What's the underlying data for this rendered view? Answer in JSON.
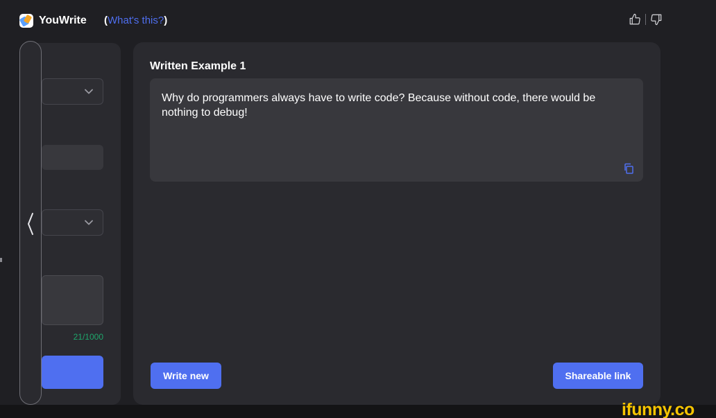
{
  "header": {
    "brand_name": "YouWrite",
    "whats_this_open": "(",
    "whats_this_link": "What's this?",
    "whats_this_close": ")"
  },
  "feedback": {
    "like_icon": "thumbs-up-icon",
    "dislike_icon": "thumbs-down-icon"
  },
  "settings": {
    "counter": "21/1000"
  },
  "collapse_icon": "chevron-left-icon",
  "result": {
    "title": "Written Example 1",
    "text": "Why do programmers always have to write code? Because without code, there would be nothing to debug!",
    "copy_icon": "copy-icon"
  },
  "buttons": {
    "write_new": "Write new",
    "shareable_link": "Shareable link"
  },
  "watermark": "ifunny.co",
  "colors": {
    "accent": "#4f6ff0",
    "background": "#1f1f23",
    "panel": "#2a2a2f",
    "counter": "#1ea66b",
    "watermark": "#f5c400"
  }
}
